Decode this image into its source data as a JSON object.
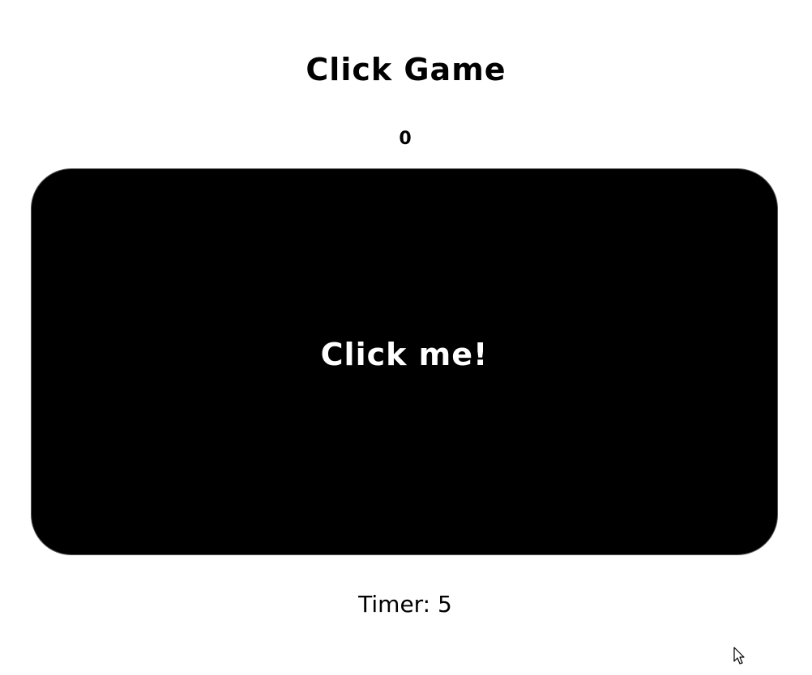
{
  "game": {
    "title": "Click Game",
    "score": "0",
    "button_label": "Click me!",
    "timer_label": "Timer:",
    "timer_value": "5"
  },
  "colors": {
    "background": "#ffffff",
    "click_area": "#000000",
    "click_area_text": "#ffffff",
    "text": "#000000"
  },
  "icons": {
    "cursor": "mouse-pointer-icon"
  }
}
